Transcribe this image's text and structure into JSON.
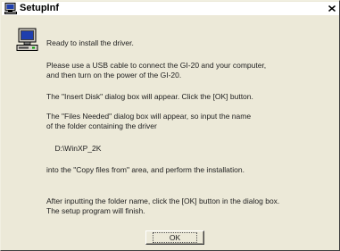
{
  "window": {
    "title": "SetupInf"
  },
  "icons": {
    "title_icon": "computer-monitor-icon",
    "message_icon": "computer-icon",
    "close": "close-icon"
  },
  "message": {
    "line1": "Ready to install the driver.",
    "para2": "Please use a USB cable to connect the GI-20 and your computer,\nand then turn on the power of the GI-20.",
    "para3": "The \"Insert Disk\" dialog box will appear. Click the [OK] button.",
    "para4": "The \"Files Needed\" dialog box will appear, so input the name\nof the folder containing the driver",
    "folder": "    D:\\WinXP_2K",
    "para5": "into the \"Copy files from\" area, and perform the installation.",
    "para6": "After inputting the folder name, click the [OK] button in the dialog box.\nThe setup program will finish."
  },
  "buttons": {
    "ok_label": "OK"
  },
  "colors": {
    "window_bg": "#ece9d8",
    "titlebar_bg": "#ffffff",
    "text": "#222222"
  }
}
